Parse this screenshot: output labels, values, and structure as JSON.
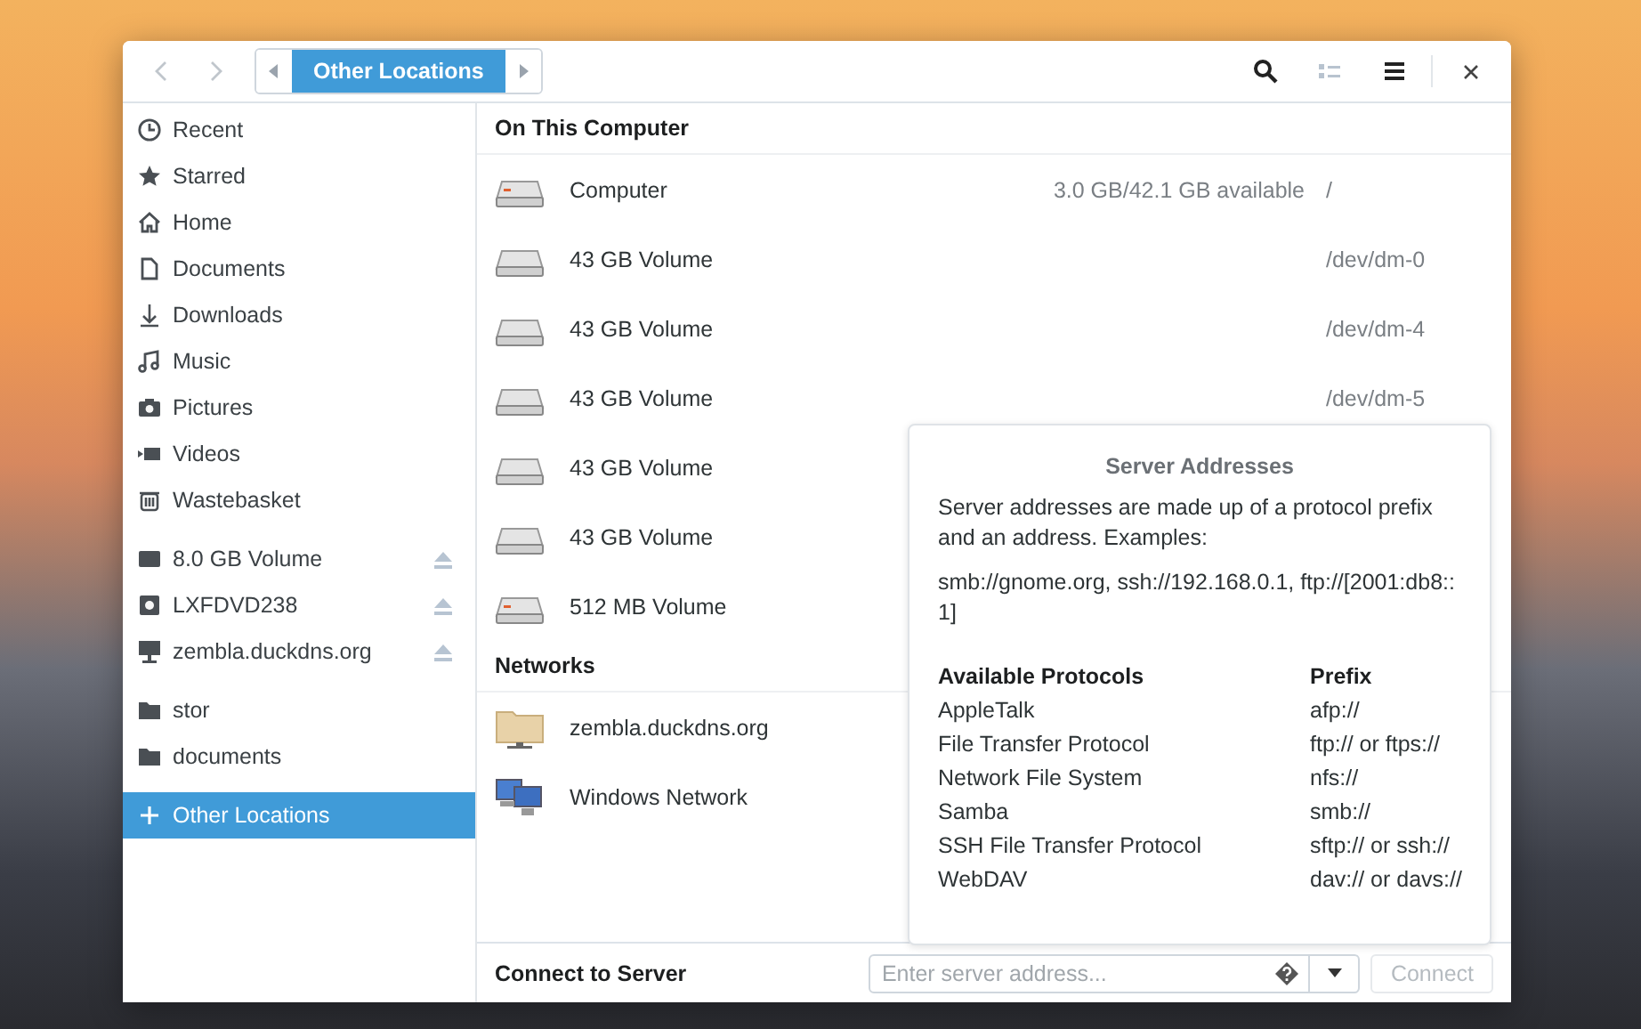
{
  "header": {
    "back": {
      "disabled": true
    },
    "forward": {
      "disabled": true
    },
    "path": [
      {
        "label": "Other Locations",
        "selected": true
      }
    ],
    "view_toggle": {
      "disabled": true
    }
  },
  "sidebar": {
    "groups": [
      {
        "items": [
          {
            "label": "Recent",
            "kind": "recent",
            "selected": false,
            "eject": false
          },
          {
            "label": "Starred",
            "kind": "star",
            "selected": false,
            "eject": false
          },
          {
            "label": "Home",
            "kind": "home",
            "selected": false,
            "eject": false
          },
          {
            "label": "Documents",
            "kind": "document",
            "selected": false,
            "eject": false
          },
          {
            "label": "Downloads",
            "kind": "download",
            "selected": false,
            "eject": false
          },
          {
            "label": "Music",
            "kind": "music",
            "selected": false,
            "eject": false
          },
          {
            "label": "Pictures",
            "kind": "camera",
            "selected": false,
            "eject": false
          },
          {
            "label": "Videos",
            "kind": "video",
            "selected": false,
            "eject": false
          },
          {
            "label": "Wastebasket",
            "kind": "trash",
            "selected": false,
            "eject": false
          }
        ]
      },
      {
        "items": [
          {
            "label": "8.0 GB Volume",
            "kind": "drive",
            "selected": false,
            "eject": true
          },
          {
            "label": "LXFDVD238",
            "kind": "disc",
            "selected": false,
            "eject": true
          },
          {
            "label": "zembla.duckdns.org",
            "kind": "server",
            "selected": false,
            "eject": true
          }
        ]
      },
      {
        "items": [
          {
            "label": "stor",
            "kind": "folder",
            "selected": false,
            "eject": false
          },
          {
            "label": "documents",
            "kind": "folder",
            "selected": false,
            "eject": false
          }
        ]
      },
      {
        "items": [
          {
            "label": "Other Locations",
            "kind": "plus",
            "selected": true,
            "eject": false
          }
        ]
      }
    ]
  },
  "sections": [
    {
      "title": "On This Computer",
      "rows": [
        {
          "name": "Computer",
          "kind": "system-drive",
          "detail": "3.0 GB/42.1 GB available",
          "path": "/"
        },
        {
          "name": "43 GB Volume",
          "kind": "drive",
          "path": "/dev/dm-0"
        },
        {
          "name": "43 GB Volume",
          "kind": "drive",
          "path": "/dev/dm-4"
        },
        {
          "name": "43 GB Volume",
          "kind": "drive",
          "path": "/dev/dm-5"
        },
        {
          "name": "43 GB Volume",
          "kind": "drive",
          "path": ""
        },
        {
          "name": "43 GB Volume",
          "kind": "drive",
          "path": ""
        },
        {
          "name": "512 MB Volume",
          "kind": "system-drive",
          "path": ""
        }
      ]
    },
    {
      "title": "Networks",
      "rows": [
        {
          "name": "zembla.duckdns.org",
          "kind": "network-folder",
          "path": ""
        },
        {
          "name": "Windows Network",
          "kind": "network",
          "path": ""
        }
      ]
    }
  ],
  "popover": {
    "title": "Server Addresses",
    "text": "Server addresses are made up of a protocol prefix and an address. Examples:",
    "examples": "smb://gnome.org, ssh://192.168.0.1, ftp://[2001:db8::1]",
    "columns": [
      "Available Protocols",
      "Prefix"
    ],
    "rows": [
      [
        "AppleTalk",
        "afp://"
      ],
      [
        "File Transfer Protocol",
        "ftp:// or ftps://"
      ],
      [
        "Network File System",
        "nfs://"
      ],
      [
        "Samba",
        "smb://"
      ],
      [
        "SSH File Transfer Protocol",
        "sftp:// or ssh://"
      ],
      [
        "WebDAV",
        "dav:// or davs://"
      ]
    ]
  },
  "footer": {
    "label": "Connect to Server",
    "placeholder": "Enter server address...",
    "connect": {
      "label": "Connect",
      "disabled": true
    }
  }
}
